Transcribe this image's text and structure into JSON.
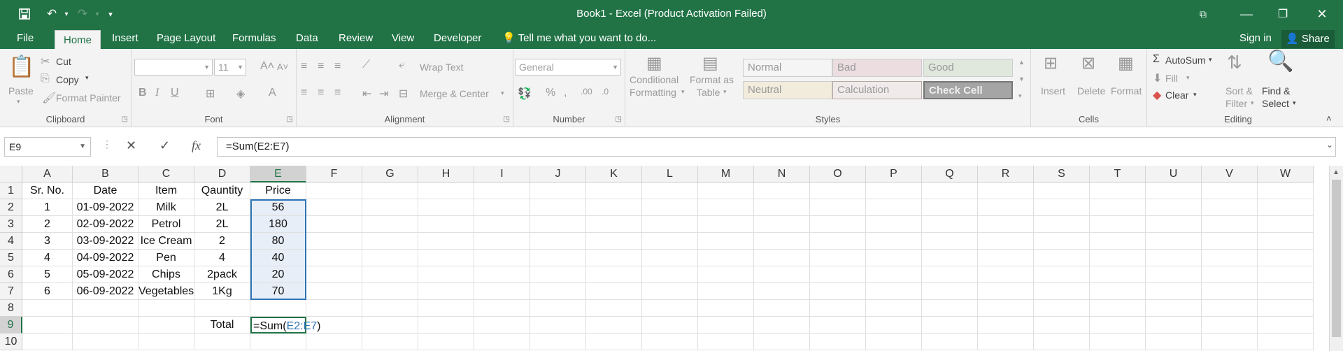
{
  "window": {
    "title": "Book1 - Excel (Product Activation Failed)"
  },
  "tabs": [
    "File",
    "Home",
    "Insert",
    "Page Layout",
    "Formulas",
    "Data",
    "Review",
    "View",
    "Developer"
  ],
  "tell_me": "Tell me what you want to do...",
  "account": {
    "sign_in": "Sign in",
    "share": "Share"
  },
  "ribbon": {
    "clipboard": {
      "label": "Clipboard",
      "paste": "Paste",
      "cut": "Cut",
      "copy": "Copy",
      "format_painter": "Format Painter"
    },
    "font": {
      "label": "Font",
      "font_name": "",
      "font_size": "11"
    },
    "alignment": {
      "label": "Alignment",
      "wrap_text": "Wrap Text",
      "merge_center": "Merge & Center"
    },
    "number": {
      "label": "Number",
      "format": "General"
    },
    "styles": {
      "label": "Styles",
      "conditional_formatting": [
        "Conditional",
        "Formatting"
      ],
      "format_as_table": [
        "Format as",
        "Table"
      ],
      "cells": [
        "Normal",
        "Bad",
        "Good",
        "Neutral",
        "Calculation",
        "Check Cell"
      ]
    },
    "cells": {
      "label": "Cells",
      "insert": "Insert",
      "delete": "Delete",
      "format": "Format"
    },
    "editing": {
      "label": "Editing",
      "autosum": "AutoSum",
      "fill": "Fill",
      "clear": "Clear",
      "sort_filter": [
        "Sort &",
        "Filter"
      ],
      "find_select": [
        "Find &",
        "Select"
      ]
    }
  },
  "formula_bar": {
    "name_box": "E9",
    "formula": "=Sum(E2:E7)"
  },
  "sheet": {
    "columns": [
      "A",
      "B",
      "C",
      "D",
      "E",
      "F",
      "G",
      "H",
      "I",
      "J",
      "K",
      "L",
      "M",
      "N",
      "O",
      "P",
      "Q",
      "R",
      "S",
      "T",
      "U",
      "V",
      "W"
    ],
    "rows": [
      [
        "Sr. No.",
        "Date",
        "Item",
        "Qauntity",
        "Price"
      ],
      [
        "1",
        "01-09-2022",
        "Milk",
        "2L",
        "56"
      ],
      [
        "2",
        "02-09-2022",
        "Petrol",
        "2L",
        "180"
      ],
      [
        "3",
        "03-09-2022",
        "Ice Cream",
        "2",
        "80"
      ],
      [
        "4",
        "04-09-2022",
        "Pen",
        "4",
        "40"
      ],
      [
        "5",
        "05-09-2022",
        "Chips",
        "2pack",
        "20"
      ],
      [
        "6",
        "06-09-2022",
        "Vegetables",
        "1Kg",
        "70"
      ],
      [
        "",
        "",
        "",
        "",
        ""
      ],
      [
        "",
        "",
        "",
        "Total",
        ""
      ],
      [
        "",
        "",
        "",
        "",
        ""
      ]
    ],
    "row_numbers": [
      "1",
      "2",
      "3",
      "4",
      "5",
      "6",
      "7",
      "8",
      "9",
      "10"
    ],
    "active_cell": "E9",
    "active_cell_edit": {
      "prefix": "=Sum(",
      "ref": "E2:E7",
      "suffix": ")"
    }
  }
}
